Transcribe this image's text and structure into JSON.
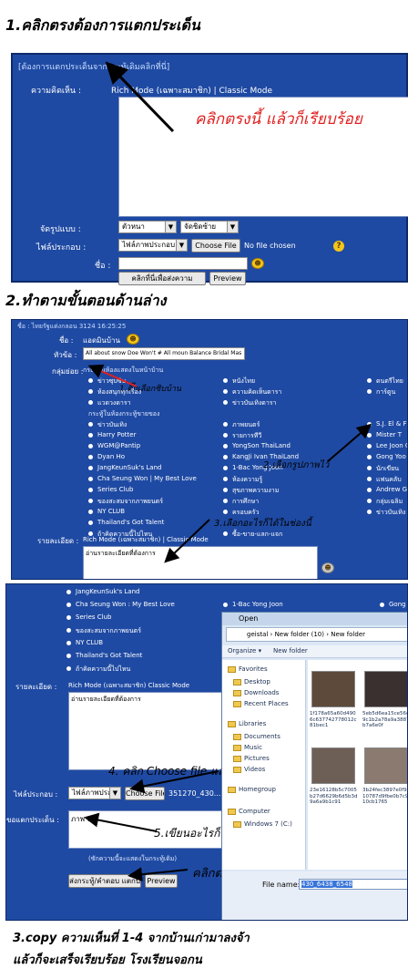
{
  "step1": {
    "heading": "1.คลิกตรงต้องการแตกประเด็น",
    "form_header": "[ต้องการแตกประเด็นจากกระทู้เดิมคลิกที่นี่]",
    "opinion_label": "ความคิดเห็น :",
    "mode_text": "Rich Mode (เฉพาะสมาชิก) | Classic Mode",
    "annotation": "คลิกตรงนี้ แล้วก็เรียบร้อย",
    "align_label": "จัดรูปแบบ :",
    "font_select": "ตัวหนา",
    "align_select": "จัดชิดซ้าย",
    "attach_label": "ไฟล์ประกอบ :",
    "attach_select": "ไฟล์ภาพประกอบ",
    "choose_file": "Choose File",
    "no_file": "No file chosen",
    "name_label": "ชื่อ :",
    "submit_label": "คลิกที่นี่เพื่อส่งความ",
    "preview_label": "Preview"
  },
  "step2": {
    "heading": "2.ทำตามขั้นตอนด้านล่าง",
    "top_text": "ชื่อ : ไทยรัฐแต่งกลอน 3124 16:25:25",
    "name_label": "ชื่อ :",
    "name_value": "แอดมินบ้าน",
    "title_label": "หัวข้อ :",
    "title_value": "All about snow Doe Won't # All moun Balance Bridal Mas",
    "group_label": "กลุ่มย่อย :",
    "group_intro": "กระทู้ในห้องแสดงในหน้าบ้าน",
    "sub_group": "กระทู้ในห้องกระทู้ขายของ",
    "col1": [
      "ข่าวซุบซิบ",
      "ห้องสนุกทุกเรื่อง",
      "แวดวงดารา",
      "ขำขำ",
      "ข่าวบันเทิง",
      "Harry Potter",
      "WGM@Pantip",
      "Dyan Ho",
      "JangKeunSuk's Land",
      "Cha Seung Won | My Best Love",
      "Series Club",
      "ของสะสมจากภาพยนตร์",
      "NY CLUB",
      "Thailand's Got Talent",
      "ถ้าคิดความนี้ไปไหน"
    ],
    "col2": [
      "หนังไทย",
      "ความคิดเห็นดารา",
      "ข่าวบันเทิงดารา",
      "ภาพยนตร์",
      "รายการทีวี",
      "YongSon ThaiLand",
      "KangJi Ivan ThaiLand",
      "1-Bac Yong Joon",
      "ห้องความรู้",
      "สุขภาพความงาม",
      "การศึกษา",
      "ครอบครัว",
      "ซื้อ-ขาย-แลก-แจก"
    ],
    "col3": [
      "ดนตรีไทย",
      "การ์ตูน",
      "S.J. El & F",
      "Mister T",
      "Lee Joon G",
      "Gong Yoo",
      "นักเขียน",
      "แฟนคลับ",
      "Andrew Ge",
      "กลุ่มเฉลิม",
      "ข่าวบันเทิง"
    ],
    "annot_tick": "1.ติ๊กเลือกซิบบ้าน",
    "annot_pick": "2.เลือกรูปภาพไว้",
    "annot_any": "3.เลือกอะไรก็ได้ในช่องนี้",
    "detail_label": "รายละเอียด :",
    "detail_mode": "Rich Mode (เฉพาะสมาชิก) | Classic Mode",
    "detail_text": "อ่านรายละเอียดที่ต้องการ"
  },
  "step3": {
    "items": [
      "JangKeunSuk's Land",
      "Cha Seung Won : My Best Love",
      "Series Club",
      "ของสะสมจากภาพยนตร์",
      "NY CLUB",
      "Thailand's Got Talent",
      "ถ้าคิดความนี้ไปไหน"
    ],
    "right_items": [
      "1-Bac Yong Joon",
      "Gong Yo"
    ],
    "detail_label": "รายละเอียด :",
    "detail_mode": "Rich Mode (เฉพาะสมาชิก)  Classic Mode",
    "detail_text": "อ่านรายละเอียดที่ต้องการ",
    "annot_choose": "4. คลิก Choose file แล้วเลือกรูป",
    "attach_label": "ไฟล์ประกอบ :",
    "attach_select": "ไฟล์ภาพประก",
    "choose_file": "Choose File",
    "file_name": "351270_430...6548",
    "issue_label": "ขอแตกประเด็น :",
    "issue_value": "ภาพ 1",
    "annot_write": "5.เขียนอะไรก็ได้",
    "hint_text": "(ซักความนี้จะแสดงในกระทู้เดิม)",
    "annot_done": "คลิกตรงนี้ เท่านี้ก็เรียบร้อย",
    "submit_label": "ส่งกระทู้/คำตอบ แตกประเด็น",
    "preview_label": "Preview"
  },
  "dialog": {
    "title": "Open",
    "path": "geistal  ›  New folder (10)  ›  New folder",
    "organize": "Organize ▾",
    "new_folder": "New folder",
    "nav": [
      "Favorites",
      "Desktop",
      "Downloads",
      "Recent Places",
      "Libraries",
      "Documents",
      "Music",
      "Pictures",
      "Videos",
      "Homegroup",
      "Computer",
      "Windows 7 (C:)"
    ],
    "files": [
      "1f178a65a60d4906c637742778012c81bec1",
      "5eb5d6ea15ce56c9c1b2a78a9a3887b7a6e0f",
      "23e16128b5c7005b27d6629b6d5b3d9a6a9b1c91",
      "3b24fec3897e0f9e10787d9fbe0b7c9a10cb1765"
    ],
    "filename_label": "File name:",
    "filename_value": "430_6438_6548"
  },
  "footer": {
    "line1": "3.copy ความเห็นที่ 1-4 จากบ้านเก่ามาลงจ้า",
    "line2": "แล้วก็จะเสร็จเรียบร้อย โรงเรียนจอกน"
  },
  "colors": {
    "panel": "#1f4aa3",
    "annotation_red": "#e02020"
  }
}
